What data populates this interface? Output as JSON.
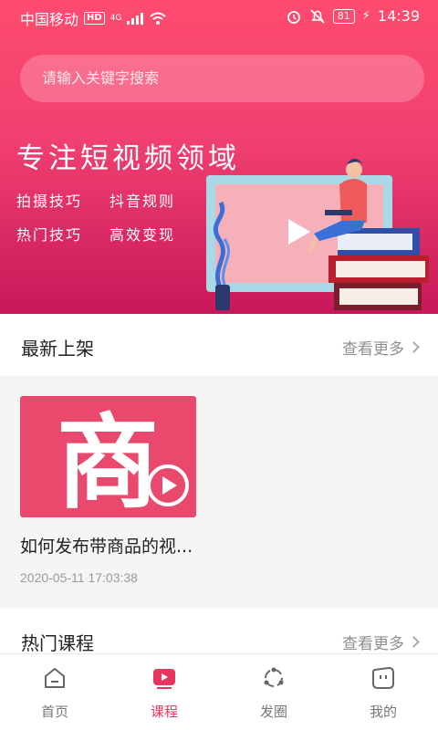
{
  "status": {
    "carrier": "中国移动",
    "hd": "HD",
    "network": "4G",
    "battery": "81",
    "time": "14:39"
  },
  "search": {
    "placeholder": "请输入关键字搜索"
  },
  "hero": {
    "title": "专注短视频领域",
    "tags": [
      "拍摄技巧",
      "抖音规则",
      "热门技巧",
      "高效变现"
    ]
  },
  "sections": {
    "latest": {
      "title": "最新上架",
      "more": "查看更多"
    },
    "hot": {
      "title": "热门课程",
      "more": "查看更多"
    }
  },
  "card": {
    "thumb_text": "商",
    "title": "如何发布带商品的视...",
    "date": "2020-05-11 17:03:38"
  },
  "tabs": [
    {
      "label": "首页",
      "icon": "home-icon"
    },
    {
      "label": "课程",
      "icon": "course-play-icon"
    },
    {
      "label": "发圈",
      "icon": "share-circle-icon"
    },
    {
      "label": "我的",
      "icon": "profile-icon"
    }
  ],
  "colors": {
    "accent": "#e8375f",
    "hero_top": "#ff4b6e",
    "hero_bottom": "#c8185a"
  }
}
